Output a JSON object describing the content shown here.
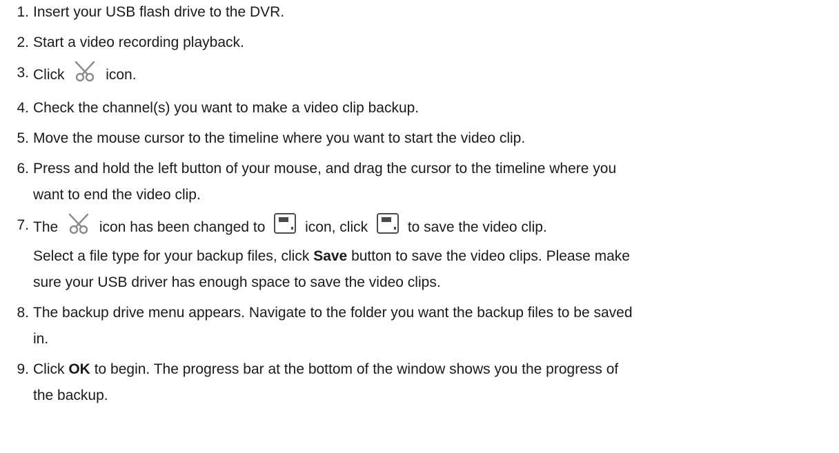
{
  "steps": [
    {
      "number": "1.",
      "text": "Insert your USB flash drive to the DVR."
    },
    {
      "number": "2.",
      "text": "Start a video recording playback."
    },
    {
      "number": "3.",
      "pre": "Click",
      "post": "icon.",
      "icon": "scissors-icon"
    },
    {
      "number": "4.",
      "text": "Check the channel(s) you want to make a video clip backup."
    },
    {
      "number": "5.",
      "text": "Move the mouse cursor to the timeline where you want to start the video clip."
    },
    {
      "number": "6.",
      "line1": "Press and hold the left button of your mouse, and drag the cursor to the timeline where you",
      "line2": "want to end the video clip."
    },
    {
      "number": "7.",
      "a": "The",
      "b": "icon has been changed to",
      "c": "icon, click",
      "d": "to save the video clip.",
      "sub_pre": "Select a file type for your backup files, click",
      "sub_bold": "Save",
      "sub_post": "button to save the video clips. Please make",
      "sub_line2": "sure your USB driver has enough space to save the video clips.",
      "icons": [
        "scissors-icon",
        "save-icon"
      ]
    },
    {
      "number": "8.",
      "line1": "The backup drive menu appears. Navigate to the folder you want the backup files to be saved",
      "line2": "in."
    },
    {
      "number": "9.",
      "pre": "Click",
      "bold": "OK",
      "post": "to begin. The progress bar at the bottom of the window shows you the progress of",
      "line2": "the backup."
    }
  ]
}
